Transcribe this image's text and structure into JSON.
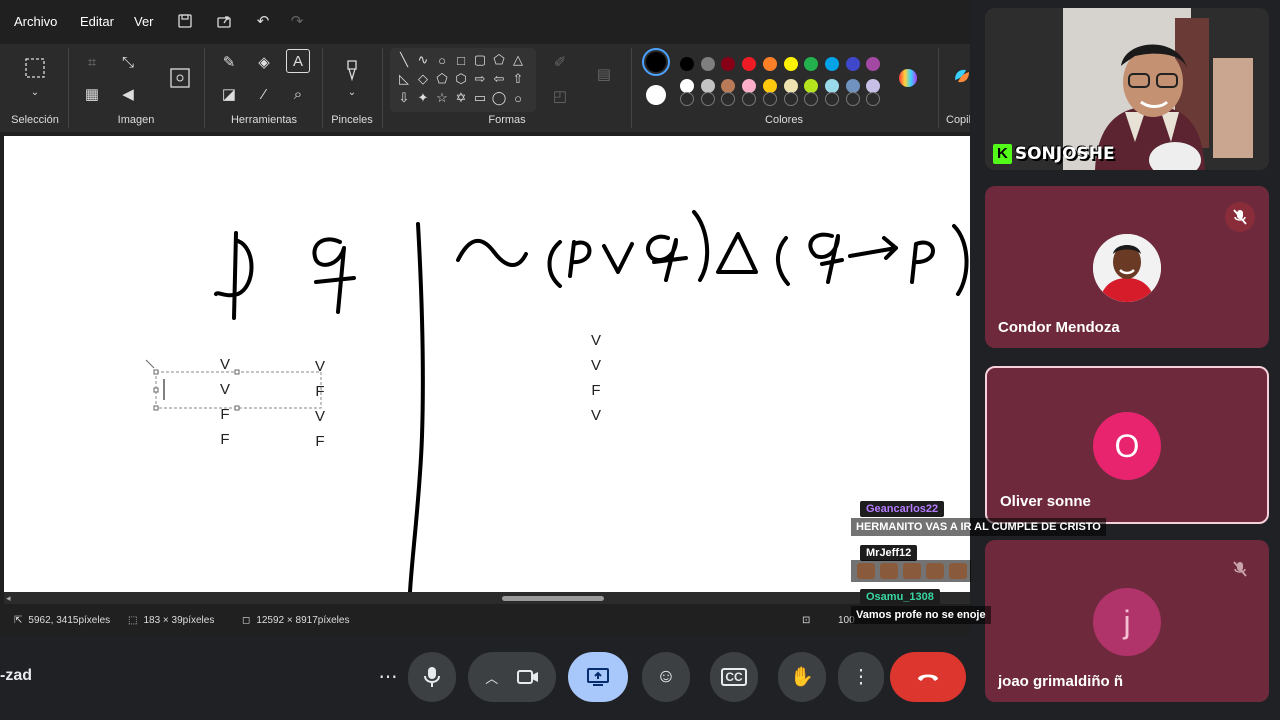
{
  "paint": {
    "menu": {
      "file": "Archivo",
      "edit": "Editar",
      "view": "Ver"
    },
    "groups": {
      "selection": "Selección",
      "image": "Imagen",
      "tools": "Herramientas",
      "brushes": "Pinceles",
      "shapes": "Formas",
      "colors": "Colores",
      "copilot": "Copil"
    },
    "palette_row1": [
      "#000000",
      "#7f7f7f",
      "#880015",
      "#ed1c24",
      "#ff7f27",
      "#fff200",
      "#22b14c",
      "#00a2e8",
      "#3f48cc",
      "#a349a4"
    ],
    "palette_row2": [
      "#ffffff",
      "#c3c3c3",
      "#b97a57",
      "#ffaec9",
      "#ffc90e",
      "#efe4b0",
      "#b5e61d",
      "#99d9ea",
      "#7092be",
      "#c8bfe7"
    ],
    "primary_color": "#000000",
    "secondary_color": "#ffffff",
    "canvas": {
      "col_p": [
        "V",
        "V",
        "F",
        "F"
      ],
      "col_q": [
        "V",
        "F",
        "V",
        "F"
      ],
      "col_result": [
        "V",
        "V",
        "F",
        "V"
      ]
    },
    "status": {
      "cursor": "5962, 3415píxeles",
      "selection": "183 × 39píxeles",
      "image_size": "12592 × 8917píxeles",
      "zoom": "100"
    }
  },
  "meet": {
    "participants": [
      {
        "name": "Condor Mendoza",
        "muted": true
      },
      {
        "name": "Oliver sonne",
        "initial": "O",
        "color": "#e8246f"
      },
      {
        "name": "joao grimaldiño ñ",
        "initial": "j",
        "muted": true
      }
    ],
    "streamer_tag": "SONJOSHE",
    "presenter_fragment": "-zad"
  },
  "chat": [
    {
      "user": "Geancarlos22",
      "color": "#b57cff",
      "text": "HERMANITO VAS A IR AL CUMPLE DE CRISTO"
    },
    {
      "user": "MrJeff12",
      "color": "#ffffff",
      "text": ""
    },
    {
      "user": "Osamu_1308",
      "color": "#38d8a0",
      "text": "Vamos profe no se enoje"
    }
  ]
}
